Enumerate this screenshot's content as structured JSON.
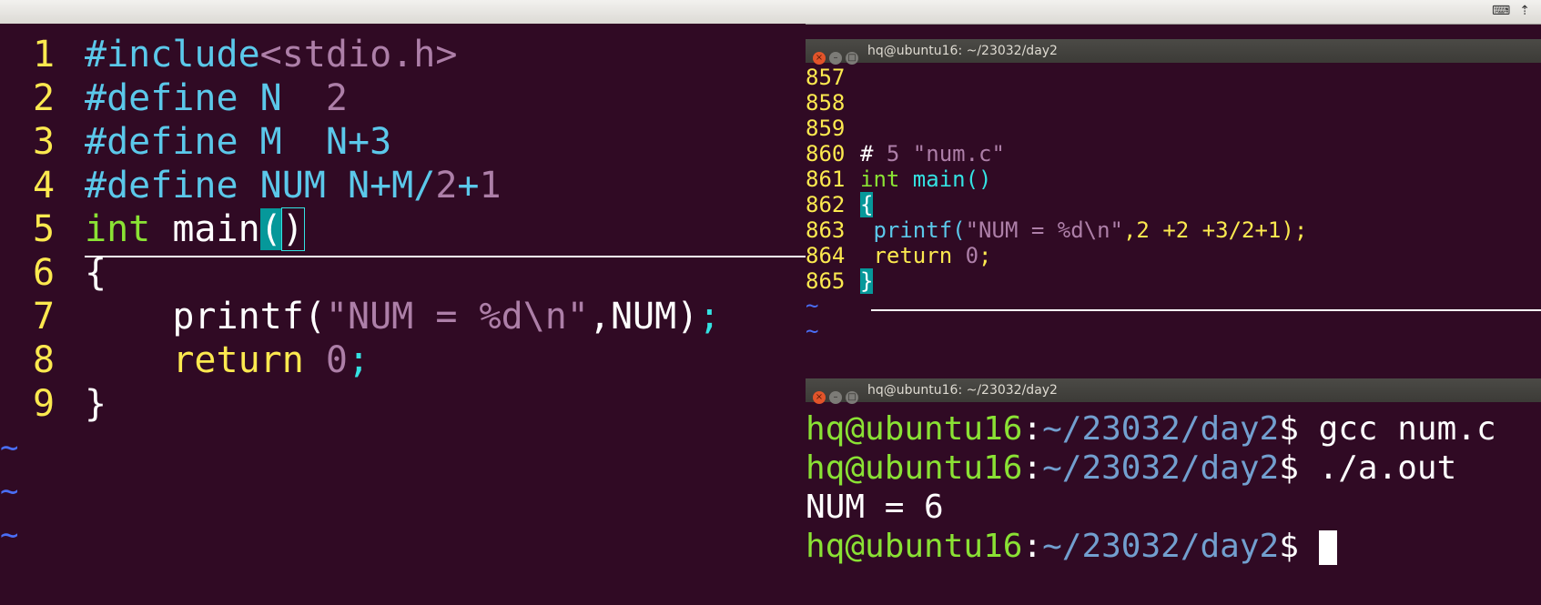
{
  "tray": {
    "keyboard_icon": "keyboard-icon",
    "arrow_icon": "upload-arrow-icon"
  },
  "editor": {
    "lines": [
      {
        "n": "1",
        "parts": [
          {
            "t": "#include",
            "c": "pp"
          },
          {
            "t": "<stdio.h>",
            "c": "str"
          }
        ]
      },
      {
        "n": "2",
        "parts": [
          {
            "t": "#define N  ",
            "c": "pp"
          },
          {
            "t": "2",
            "c": "num"
          }
        ]
      },
      {
        "n": "3",
        "parts": [
          {
            "t": "#define M  N+3",
            "c": "pp"
          }
        ]
      },
      {
        "n": "4",
        "parts": [
          {
            "t": "#define NUM N+M/",
            "c": "pp"
          },
          {
            "t": "2",
            "c": "num"
          },
          {
            "t": "+",
            "c": "pp"
          },
          {
            "t": "1",
            "c": "num"
          }
        ]
      },
      {
        "n": "5",
        "parts": [
          {
            "t": "int",
            "c": "kw-type"
          },
          {
            "t": " main",
            "c": "wht"
          },
          {
            "t": "(",
            "c": "match"
          },
          {
            "t": ")",
            "c": "match2"
          }
        ]
      },
      {
        "n": "6",
        "parts": [
          {
            "t": "{",
            "c": "wht"
          }
        ]
      },
      {
        "n": "7",
        "parts": [
          {
            "t": "    printf(",
            "c": "wht"
          },
          {
            "t": "\"NUM = %d\\n\"",
            "c": "str"
          },
          {
            "t": ",NUM)",
            "c": "wht"
          },
          {
            "t": ";",
            "c": "punct"
          }
        ]
      },
      {
        "n": "8",
        "parts": [
          {
            "t": "    return ",
            "c": "kw"
          },
          {
            "t": "0",
            "c": "num"
          },
          {
            "t": ";",
            "c": "punct"
          }
        ]
      },
      {
        "n": "9",
        "parts": [
          {
            "t": "}",
            "c": "wht"
          }
        ]
      }
    ],
    "tildes": [
      "~",
      "~",
      "~"
    ]
  },
  "term1": {
    "title": "hq@ubuntu16: ~/23032/day2",
    "lines": [
      {
        "n": "857",
        "parts": []
      },
      {
        "n": "858",
        "parts": []
      },
      {
        "n": "859",
        "parts": []
      },
      {
        "n": "860",
        "parts": [
          {
            "t": "# ",
            "c": "wht"
          },
          {
            "t": "5",
            "c": "num"
          },
          {
            "t": " \"num.c\"",
            "c": "str"
          }
        ]
      },
      {
        "n": "861",
        "parts": [
          {
            "t": "int",
            "c": "kw-type"
          },
          {
            "t": " main()",
            "c": "punct"
          }
        ]
      },
      {
        "n": "862",
        "parts": [
          {
            "t": "{",
            "c": "match"
          }
        ]
      },
      {
        "n": "863",
        "parts": [
          {
            "t": " printf(",
            "c": "pp"
          },
          {
            "t": "\"NUM = %d\\n\"",
            "c": "str"
          },
          {
            "t": ",2 +2 +3/2+1);",
            "c": "kw"
          }
        ]
      },
      {
        "n": "864",
        "parts": [
          {
            "t": " return ",
            "c": "kw"
          },
          {
            "t": "0",
            "c": "num"
          },
          {
            "t": ";",
            "c": "kw"
          }
        ]
      },
      {
        "n": "865",
        "parts": [
          {
            "t": "}",
            "c": "match"
          }
        ]
      }
    ],
    "tildes": [
      "~",
      "~"
    ]
  },
  "term2": {
    "title": "hq@ubuntu16: ~/23032/day2",
    "user": "hq@ubuntu16",
    "sep": ":",
    "path": "~/23032/day2",
    "dollar": "$ ",
    "cmd1": "gcc num.c",
    "cmd2": "./a.out",
    "output": "NUM = 6"
  }
}
